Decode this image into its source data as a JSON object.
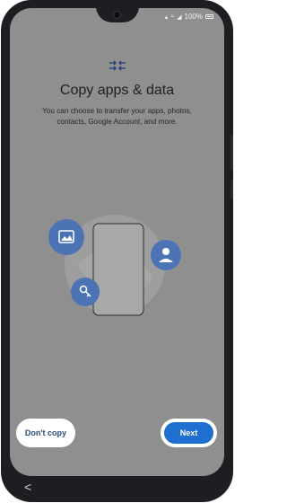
{
  "status_bar": {
    "battery": "100%",
    "signal_icon": "signal-icon",
    "wifi_icon": "wifi-icon"
  },
  "header": {
    "icon": "transfer-arrows-icon",
    "title": "Copy apps & data",
    "subtitle": "You can choose to transfer your apps, photos, contacts, Google Account, and more."
  },
  "illustration": {
    "icons": [
      "image-icon",
      "person-icon",
      "key-icon",
      "phone-outline-icon"
    ]
  },
  "buttons": {
    "dont_copy": "Don't copy",
    "next": "Next"
  },
  "nav": {
    "back_icon": "back-icon",
    "back_glyph": "<"
  },
  "colors": {
    "overlay": "#8f8f8f",
    "accent": "#1e6fd0",
    "icon_circle": "#4c74b4"
  }
}
